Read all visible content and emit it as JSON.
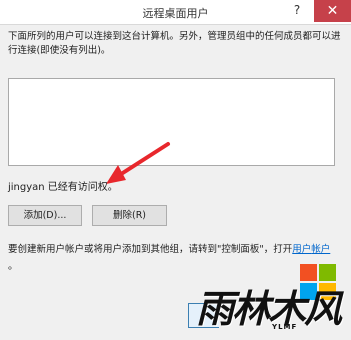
{
  "window": {
    "title": "远程桌面用户",
    "help_label": "?",
    "close_label": "✕"
  },
  "description": "下面所列的用户可以连接到这台计算机。另外，管理员组中的任何成员都可以进行连接(即使没有列出)。",
  "access_status": "jingyan 已经有访问权。",
  "buttons": {
    "add": "添加(D)...",
    "remove": "删除(R)"
  },
  "hint": {
    "prefix": "要创建新用户帐户或将用户添加到其他组，请转到\"控制面板\"，打开",
    "link": "用户",
    "suffix": "帐户",
    "line2": "。"
  },
  "watermark": {
    "text": "雨林木风",
    "sub": "YLMF",
    "colors": [
      "#f25022",
      "#7fba00",
      "#00a4ef",
      "#ffb900"
    ]
  },
  "annotation": {
    "arrow_color": "#e8272c"
  }
}
